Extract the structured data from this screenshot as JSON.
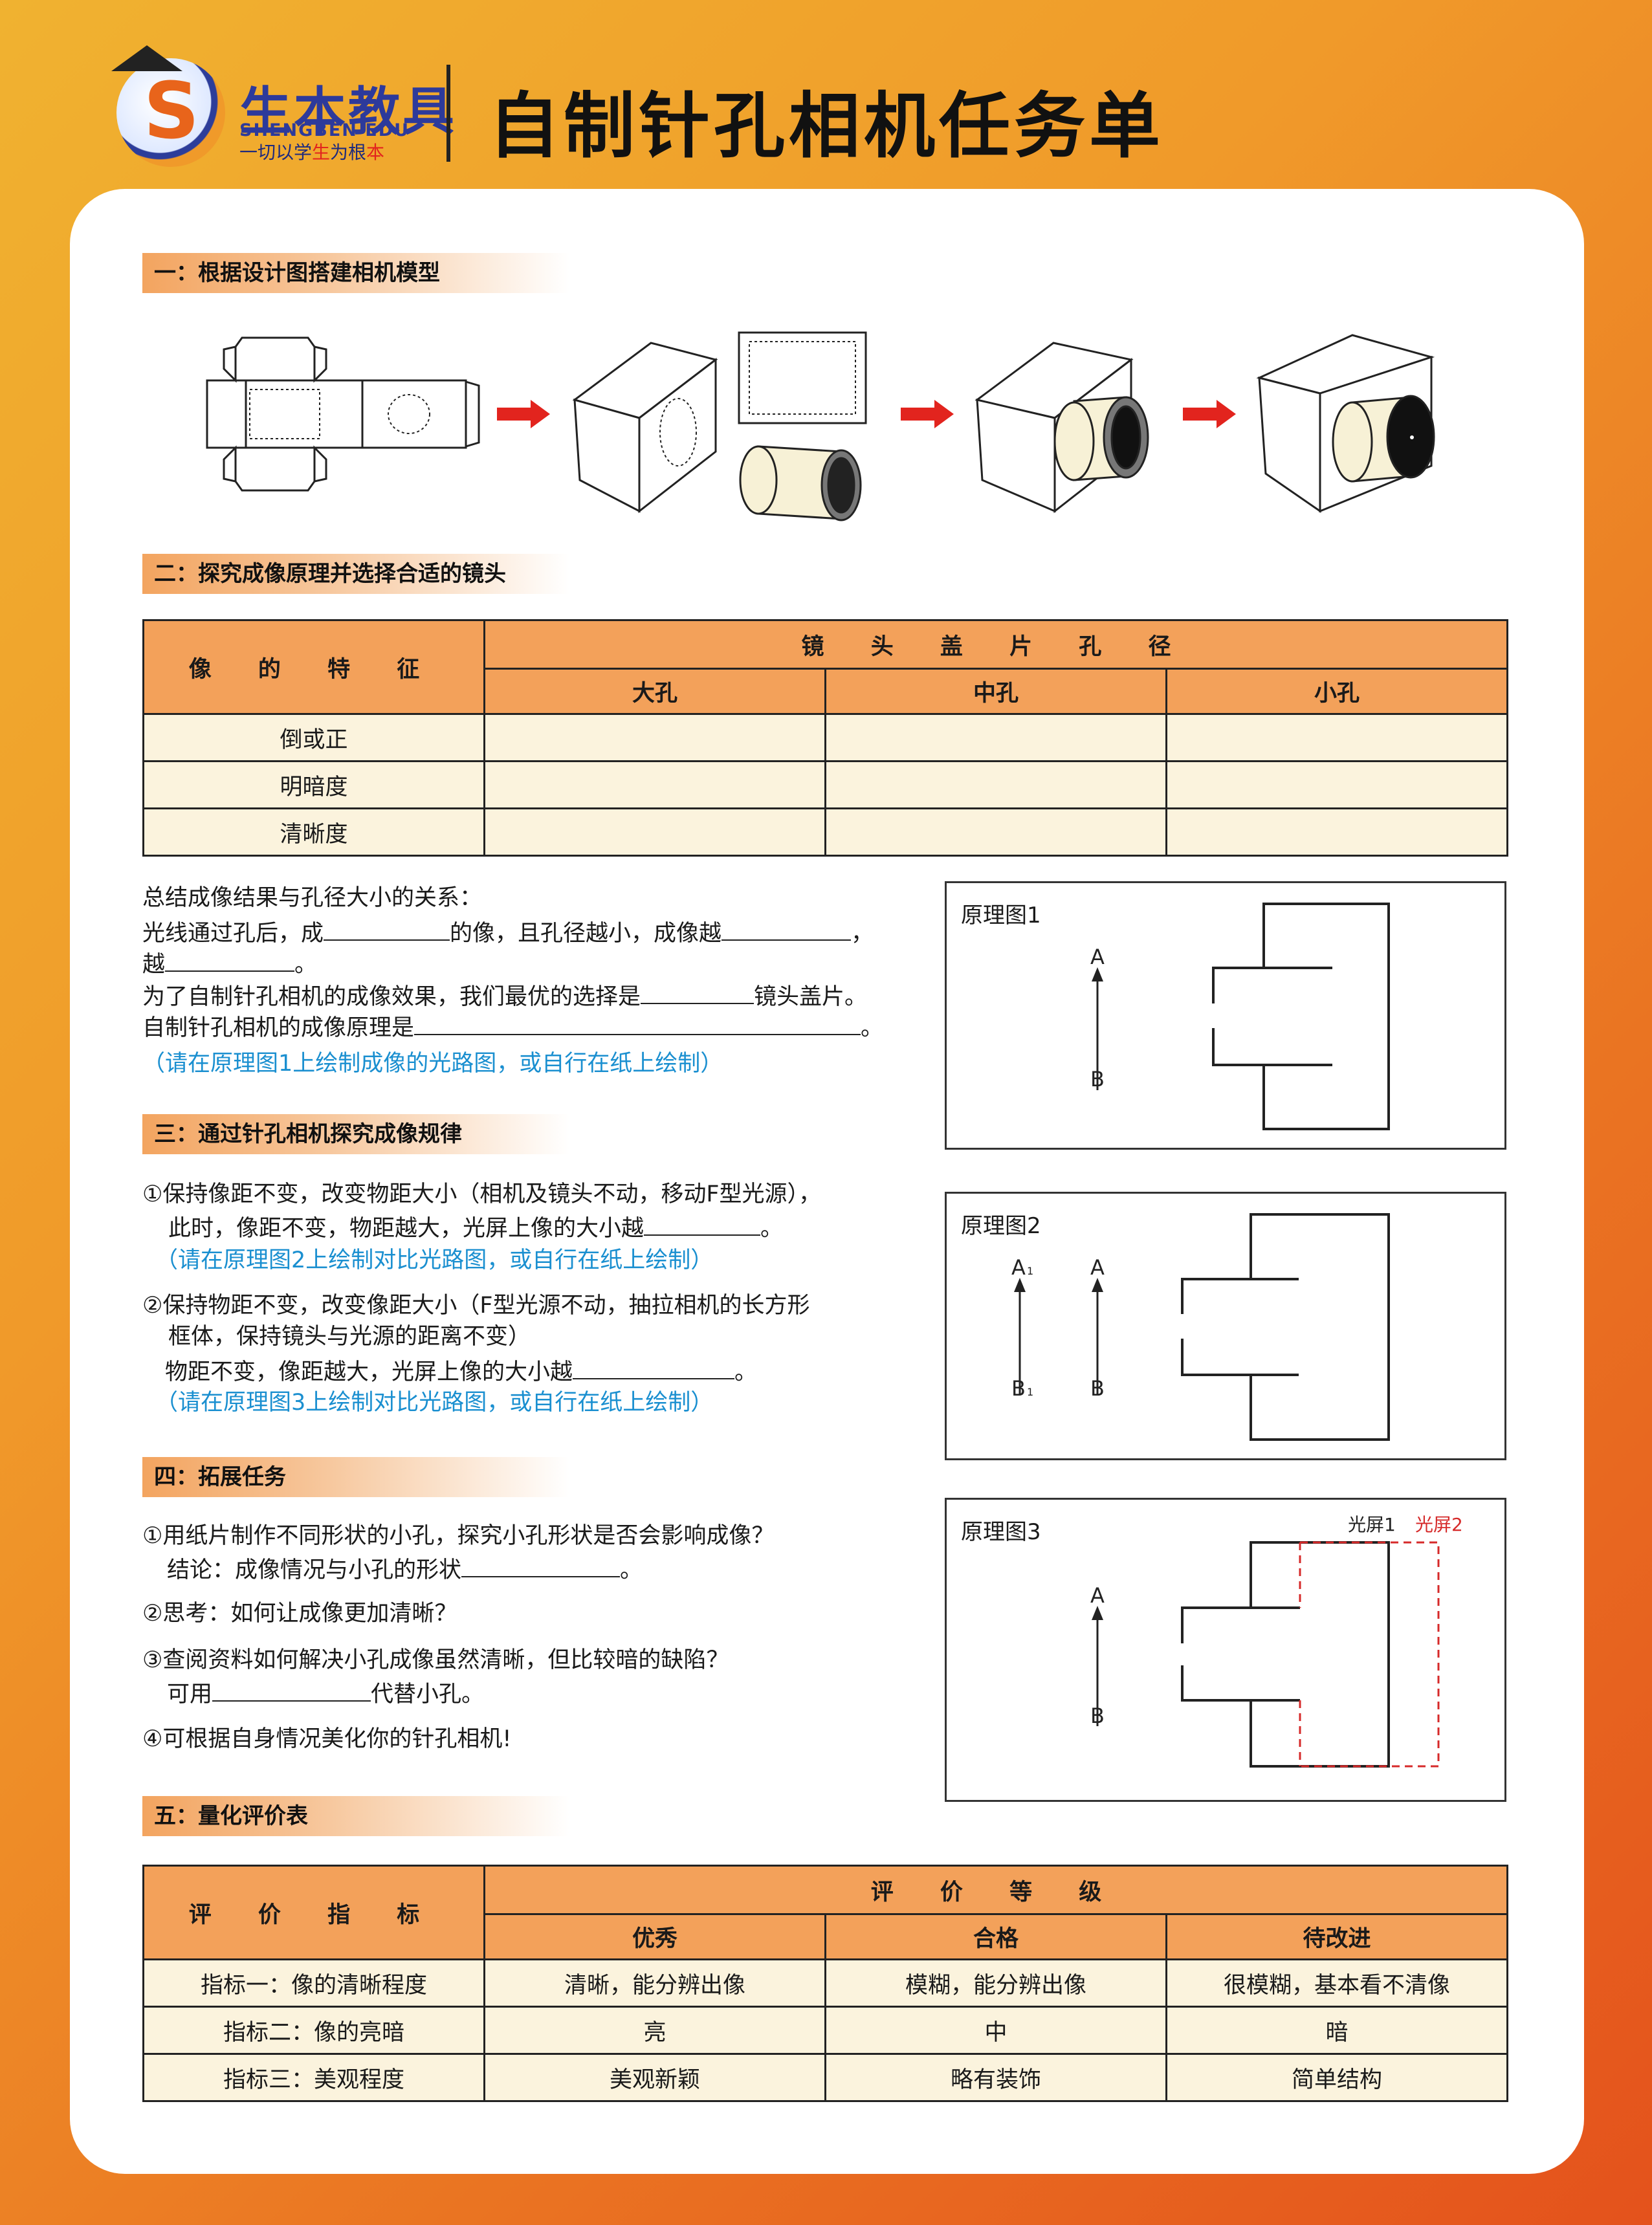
{
  "header": {
    "brand_cn": "生本教具",
    "brand_en": "SHENGBEN EDU",
    "slogan_a": "一切以学",
    "slogan_b": "生",
    "slogan_c": "为根",
    "slogan_d": "本",
    "title": "自制针孔相机任务单",
    "brand_color": "#2d3a9b",
    "accent_color": "#e8641b"
  },
  "sec1": {
    "title": "一：根据设计图搭建相机模型"
  },
  "sec2": {
    "title": "二：探究成像原理并选择合适的镜头",
    "table": {
      "row_header": "像 的 特 征",
      "group_header": "镜 头 盖 片 孔 径",
      "cols": [
        "大孔",
        "中孔",
        "小孔"
      ],
      "rows": [
        "倒或正",
        "明暗度",
        "清晰度"
      ]
    },
    "summary_title": "总结成像结果与孔径大小的关系：",
    "line1_a": "光线通过孔后，成",
    "line1_b": "的像，且孔径越小，成像越",
    "line1_c": "，",
    "line2_a": "越",
    "line2_b": "。",
    "line3_a": "为了自制针孔相机的成像效果，我们最优的选择是",
    "line3_b": "镜头盖片。",
    "line4_a": "自制针孔相机的成像原理是",
    "line4_b": "。",
    "hint": "（请在原理图1上绘制成像的光路图，或自行在纸上绘制）"
  },
  "sec3": {
    "title": "三：通过针孔相机探究成像规律",
    "p1_l1": "①保持像距不变，改变物距大小（相机及镜头不动，移动F型光源），",
    "p1_l2_a": "此时，像距不变，物距越大，光屏上像的大小越",
    "p1_l2_b": "。",
    "p1_hint": "（请在原理图2上绘制对比光路图，或自行在纸上绘制）",
    "p2_l1": "②保持物距不变，改变像距大小（F型光源不动，抽拉相机的长方形",
    "p2_l2": "框体，保持镜头与光源的距离不变）",
    "p2_l3_a": "物距不变，像距越大，光屏上像的大小越",
    "p2_l3_b": "。",
    "p2_hint": "（请在原理图3上绘制对比光路图，或自行在纸上绘制）"
  },
  "sec4": {
    "title": "四：拓展任务",
    "q1_l1": "①用纸片制作不同形状的小孔，探究小孔形状是否会影响成像？",
    "q1_l2_a": "结论：成像情况与小孔的形状",
    "q1_l2_b": "。",
    "q2": "②思考：如何让成像更加清晰？",
    "q3_l1": "③查阅资料如何解决小孔成像虽然清晰，但比较暗的缺陷？",
    "q3_l2_a": "可用",
    "q3_l2_b": "代替小孔。",
    "q4": "④可根据自身情况美化你的针孔相机!"
  },
  "diagrams": {
    "d1": {
      "title": "原理图1",
      "a": "A",
      "b": "B"
    },
    "d2": {
      "title": "原理图2",
      "a1": "A",
      "a1_sub": "1",
      "b1": "B",
      "b1_sub": "1",
      "a": "A",
      "b": "B"
    },
    "d3": {
      "title": "原理图3",
      "screen1": "光屏1",
      "screen2": "光屏2",
      "a": "A",
      "b": "B",
      "screen2_color": "#d62a2a"
    }
  },
  "sec5": {
    "title": "五：量化评价表",
    "table": {
      "row_header": "评 价 指 标",
      "group_header": "评 价 等 级",
      "cols": [
        "优秀",
        "合格",
        "待改进"
      ],
      "rows": [
        [
          "指标一：像的清晰程度",
          "清晰，能分辨出像",
          "模糊，能分辨出像",
          "很模糊，基本看不清像"
        ],
        [
          "指标二：像的亮暗",
          "亮",
          "中",
          "暗"
        ],
        [
          "指标三：美观程度",
          "美观新颖",
          "略有装饰",
          "简单结构"
        ]
      ]
    }
  }
}
